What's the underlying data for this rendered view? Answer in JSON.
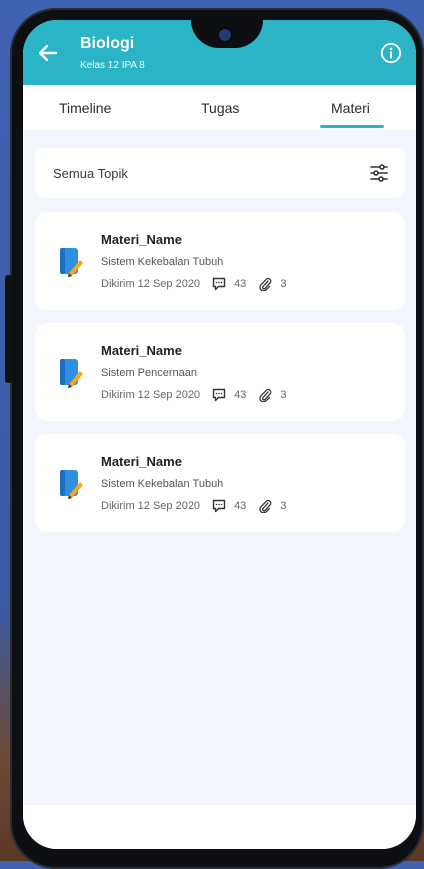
{
  "header": {
    "title": "Biologi",
    "subtitle": "Kelas 12 IPA 8",
    "accent_color": "#2ab4c5",
    "back_icon": "arrow-left-icon",
    "info_icon": "info-icon"
  },
  "tabs": [
    {
      "label": "Timeline",
      "active": false
    },
    {
      "label": "Tugas",
      "active": false
    },
    {
      "label": "Materi",
      "active": true
    }
  ],
  "filter": {
    "label": "Semua Topik",
    "icon": "sliders-icon"
  },
  "materials": [
    {
      "title": "Materi_Name",
      "topic": "Sistem Kekebalan Tubuh",
      "sent": "Dikirim 12 Sep 2020",
      "comments": "43",
      "attachments": "3"
    },
    {
      "title": "Materi_Name",
      "topic": "Sistem Pencernaan",
      "sent": "Dikirim 12 Sep 2020",
      "comments": "43",
      "attachments": "3"
    },
    {
      "title": "Materi_Name",
      "topic": "Sistem Kekebalan Tubuh",
      "sent": "Dikirim 12 Sep 2020",
      "comments": "43",
      "attachments": "3"
    }
  ]
}
